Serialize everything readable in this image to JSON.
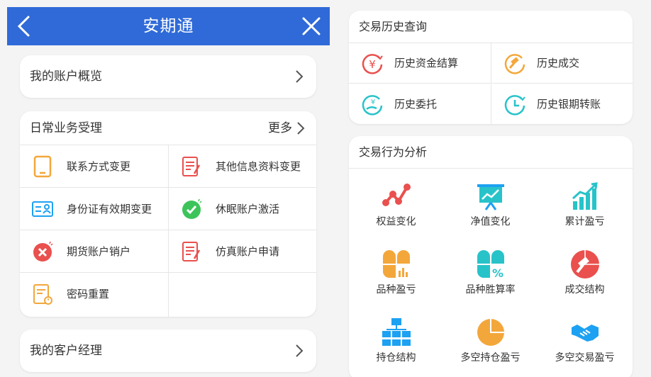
{
  "left": {
    "appbar": {
      "title": "安期通"
    },
    "account_overview": {
      "label": "我的账户概览"
    },
    "daily_business": {
      "title": "日常业务受理",
      "more": "更多",
      "items": [
        {
          "label": "联系方式变更",
          "icon": "tablet-icon"
        },
        {
          "label": "其他信息资料变更",
          "icon": "document-edit-icon"
        },
        {
          "label": "身份证有效期变更",
          "icon": "id-card-icon"
        },
        {
          "label": "休眠账户激活",
          "icon": "check-circle-icon"
        },
        {
          "label": "期货账户销户",
          "icon": "close-circle-icon"
        },
        {
          "label": "仿真账户申请",
          "icon": "document-edit-icon"
        },
        {
          "label": "密码重置",
          "icon": "password-reset-icon"
        }
      ]
    },
    "account_manager": {
      "label": "我的客户经理"
    }
  },
  "right": {
    "history": {
      "title": "交易历史查询",
      "items": [
        {
          "label": "历史资金结算",
          "icon": "yen-circle-icon"
        },
        {
          "label": "历史成交",
          "icon": "gavel-circle-icon"
        },
        {
          "label": "历史委托",
          "icon": "hand-money-icon"
        },
        {
          "label": "历史银期转账",
          "icon": "clock-circle-icon"
        }
      ]
    },
    "analysis": {
      "title": "交易行为分析",
      "items": [
        {
          "label": "权益变化",
          "icon": "line-nodes-icon"
        },
        {
          "label": "净值变化",
          "icon": "presentation-chart-icon"
        },
        {
          "label": "累计盈亏",
          "icon": "bar-trend-icon"
        },
        {
          "label": "品种盈亏",
          "icon": "quad-bars-icon"
        },
        {
          "label": "品种胜算率",
          "icon": "quad-percent-icon"
        },
        {
          "label": "成交结构",
          "icon": "gavel-red-icon"
        },
        {
          "label": "持仓结构",
          "icon": "org-chart-icon"
        },
        {
          "label": "多空持仓盈亏",
          "icon": "pie-chart-icon"
        },
        {
          "label": "多空交易盈亏",
          "icon": "handshake-icon"
        }
      ]
    }
  },
  "colors": {
    "appbar": "#2f6ad8",
    "orange": "#f3a73b",
    "red": "#e9504e",
    "teal": "#28c3c9",
    "blue": "#1da1f2",
    "green": "#3cc45a"
  }
}
